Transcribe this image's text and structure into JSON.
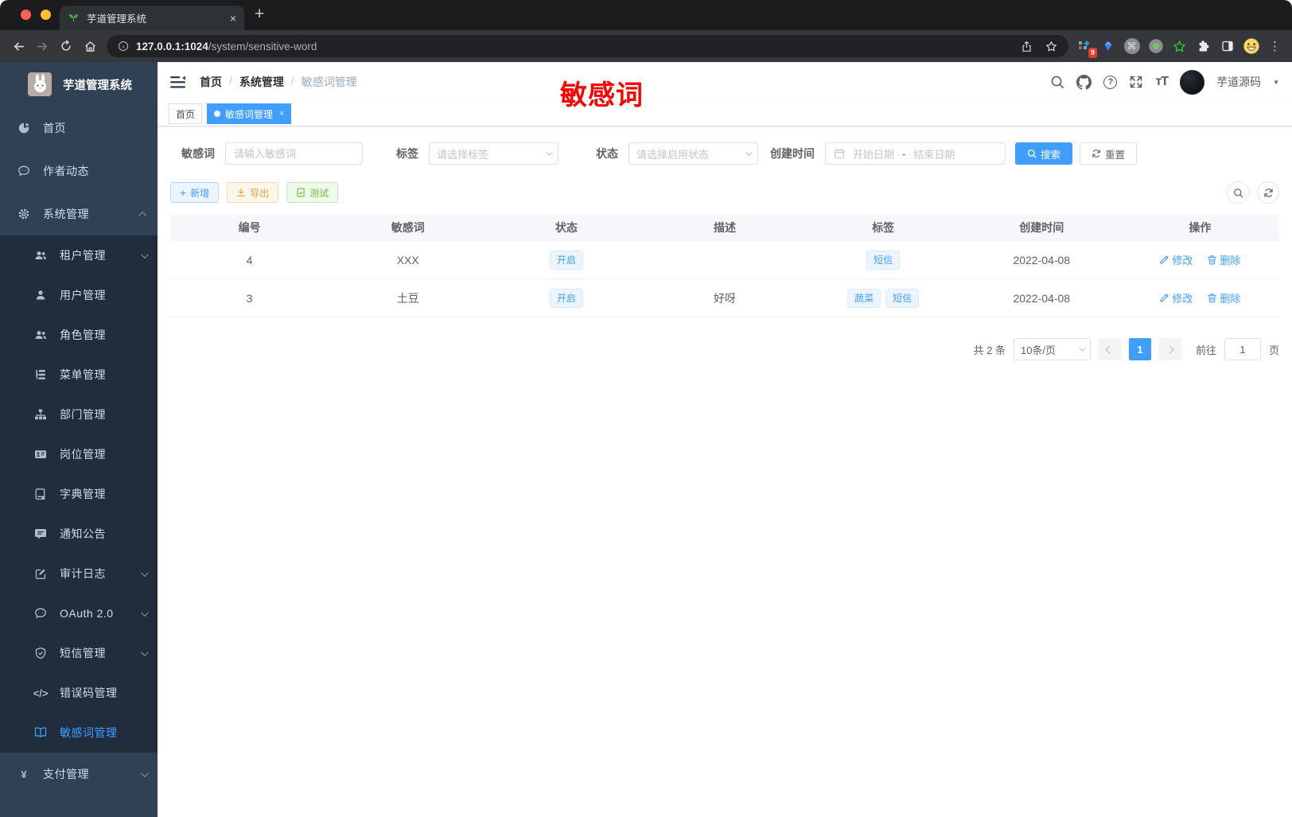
{
  "browser": {
    "tab_title": "芋道管理系统",
    "url_host": "127.0.0.1:1024",
    "url_path": "/system/sensitive-word",
    "extension_badge": "9"
  },
  "icons": {
    "question-icon": "?",
    "fontsize-icon": "тT",
    "caret-down-icon": "▼",
    "pay-icon": "¥",
    "error-code-icon": "</>",
    "command-icon": "⌘",
    "more-vert-icon": "⋮",
    "plus-icon": "+",
    "close-icon": "×",
    "new-tab-icon": "+"
  },
  "sidebar": {
    "logo_title": "芋道管理系统",
    "sections": [
      {
        "style": "root",
        "items": [
          {
            "label": "首页",
            "icon": "dashboard-icon"
          },
          {
            "label": "作者动态",
            "icon": "author-chat-icon"
          },
          {
            "label": "系统管理",
            "icon": "gear-icon",
            "chevron": "up"
          }
        ]
      },
      {
        "style": "sub",
        "items": [
          {
            "label": "租户管理",
            "icon": "tenant-users-icon",
            "chevron": "down"
          },
          {
            "label": "用户管理",
            "icon": "user-icon"
          },
          {
            "label": "角色管理",
            "icon": "role-users-icon"
          },
          {
            "label": "菜单管理",
            "icon": "menu-tree-icon"
          },
          {
            "label": "部门管理",
            "icon": "sitemap-icon"
          },
          {
            "label": "岗位管理",
            "icon": "post-badge-icon"
          },
          {
            "label": "字典管理",
            "icon": "dict-book-icon"
          },
          {
            "label": "通知公告",
            "icon": "announce-icon"
          },
          {
            "label": "审计日志",
            "icon": "audit-log-icon",
            "chevron": "down"
          },
          {
            "label": "OAuth 2.0",
            "icon": "oauth-icon",
            "chevron": "down"
          },
          {
            "label": "短信管理",
            "icon": "sms-shield-icon",
            "chevron": "down"
          },
          {
            "label": "错误码管理",
            "icon": "error-code-icon"
          },
          {
            "label": "敏感词管理",
            "icon": "sensitive-word-icon",
            "active": true
          }
        ]
      },
      {
        "style": "root",
        "items": [
          {
            "label": "支付管理",
            "icon": "pay-icon",
            "chevron": "down"
          }
        ]
      }
    ]
  },
  "navbar": {
    "breadcrumb": [
      "首页",
      "系统管理",
      "敏感词管理"
    ],
    "breadcrumb_separator": "/",
    "username": "芋道源码",
    "annotation": "敏感词"
  },
  "tags_view": [
    {
      "label": "首页",
      "active": false
    },
    {
      "label": "敏感词管理",
      "active": true
    }
  ],
  "filters": {
    "keyword": {
      "label": "敏感词",
      "placeholder": "请输入敏感词"
    },
    "tag": {
      "label": "标签",
      "placeholder": "请选择标签"
    },
    "status": {
      "label": "状态",
      "placeholder": "请选择启用状态"
    },
    "create_time": {
      "label": "创建时间",
      "start_placeholder": "开始日期",
      "separator": "-",
      "end_placeholder": "结束日期"
    },
    "search_label": "搜索",
    "reset_label": "重置"
  },
  "toolbar": {
    "add_label": "新增",
    "export_label": "导出",
    "test_label": "测试"
  },
  "table": {
    "columns": [
      "编号",
      "敏感词",
      "状态",
      "描述",
      "标签",
      "创建时间",
      "操作"
    ],
    "rows": [
      {
        "id": "4",
        "word": "XXX",
        "status": "开启",
        "description": "",
        "tags": [
          "短信"
        ],
        "create_time": "2022-04-08"
      },
      {
        "id": "3",
        "word": "土豆",
        "status": "开启",
        "description": "好呀",
        "tags": [
          "蔬菜",
          "短信"
        ],
        "create_time": "2022-04-08"
      }
    ],
    "edit_label": "修改",
    "delete_label": "删除"
  },
  "pagination": {
    "total_text": "共 2 条",
    "page_size": "10条/页",
    "current_page": "1",
    "goto_label": "前往",
    "goto_value": "1",
    "page_label": "页"
  },
  "colors": {
    "primary": "#409eff",
    "warning": "#e6a23c",
    "success": "#67c23a",
    "annotation_red": "#fb0400",
    "sidebar_bg": "#304156",
    "submenu_bg": "#1f2d3d"
  }
}
